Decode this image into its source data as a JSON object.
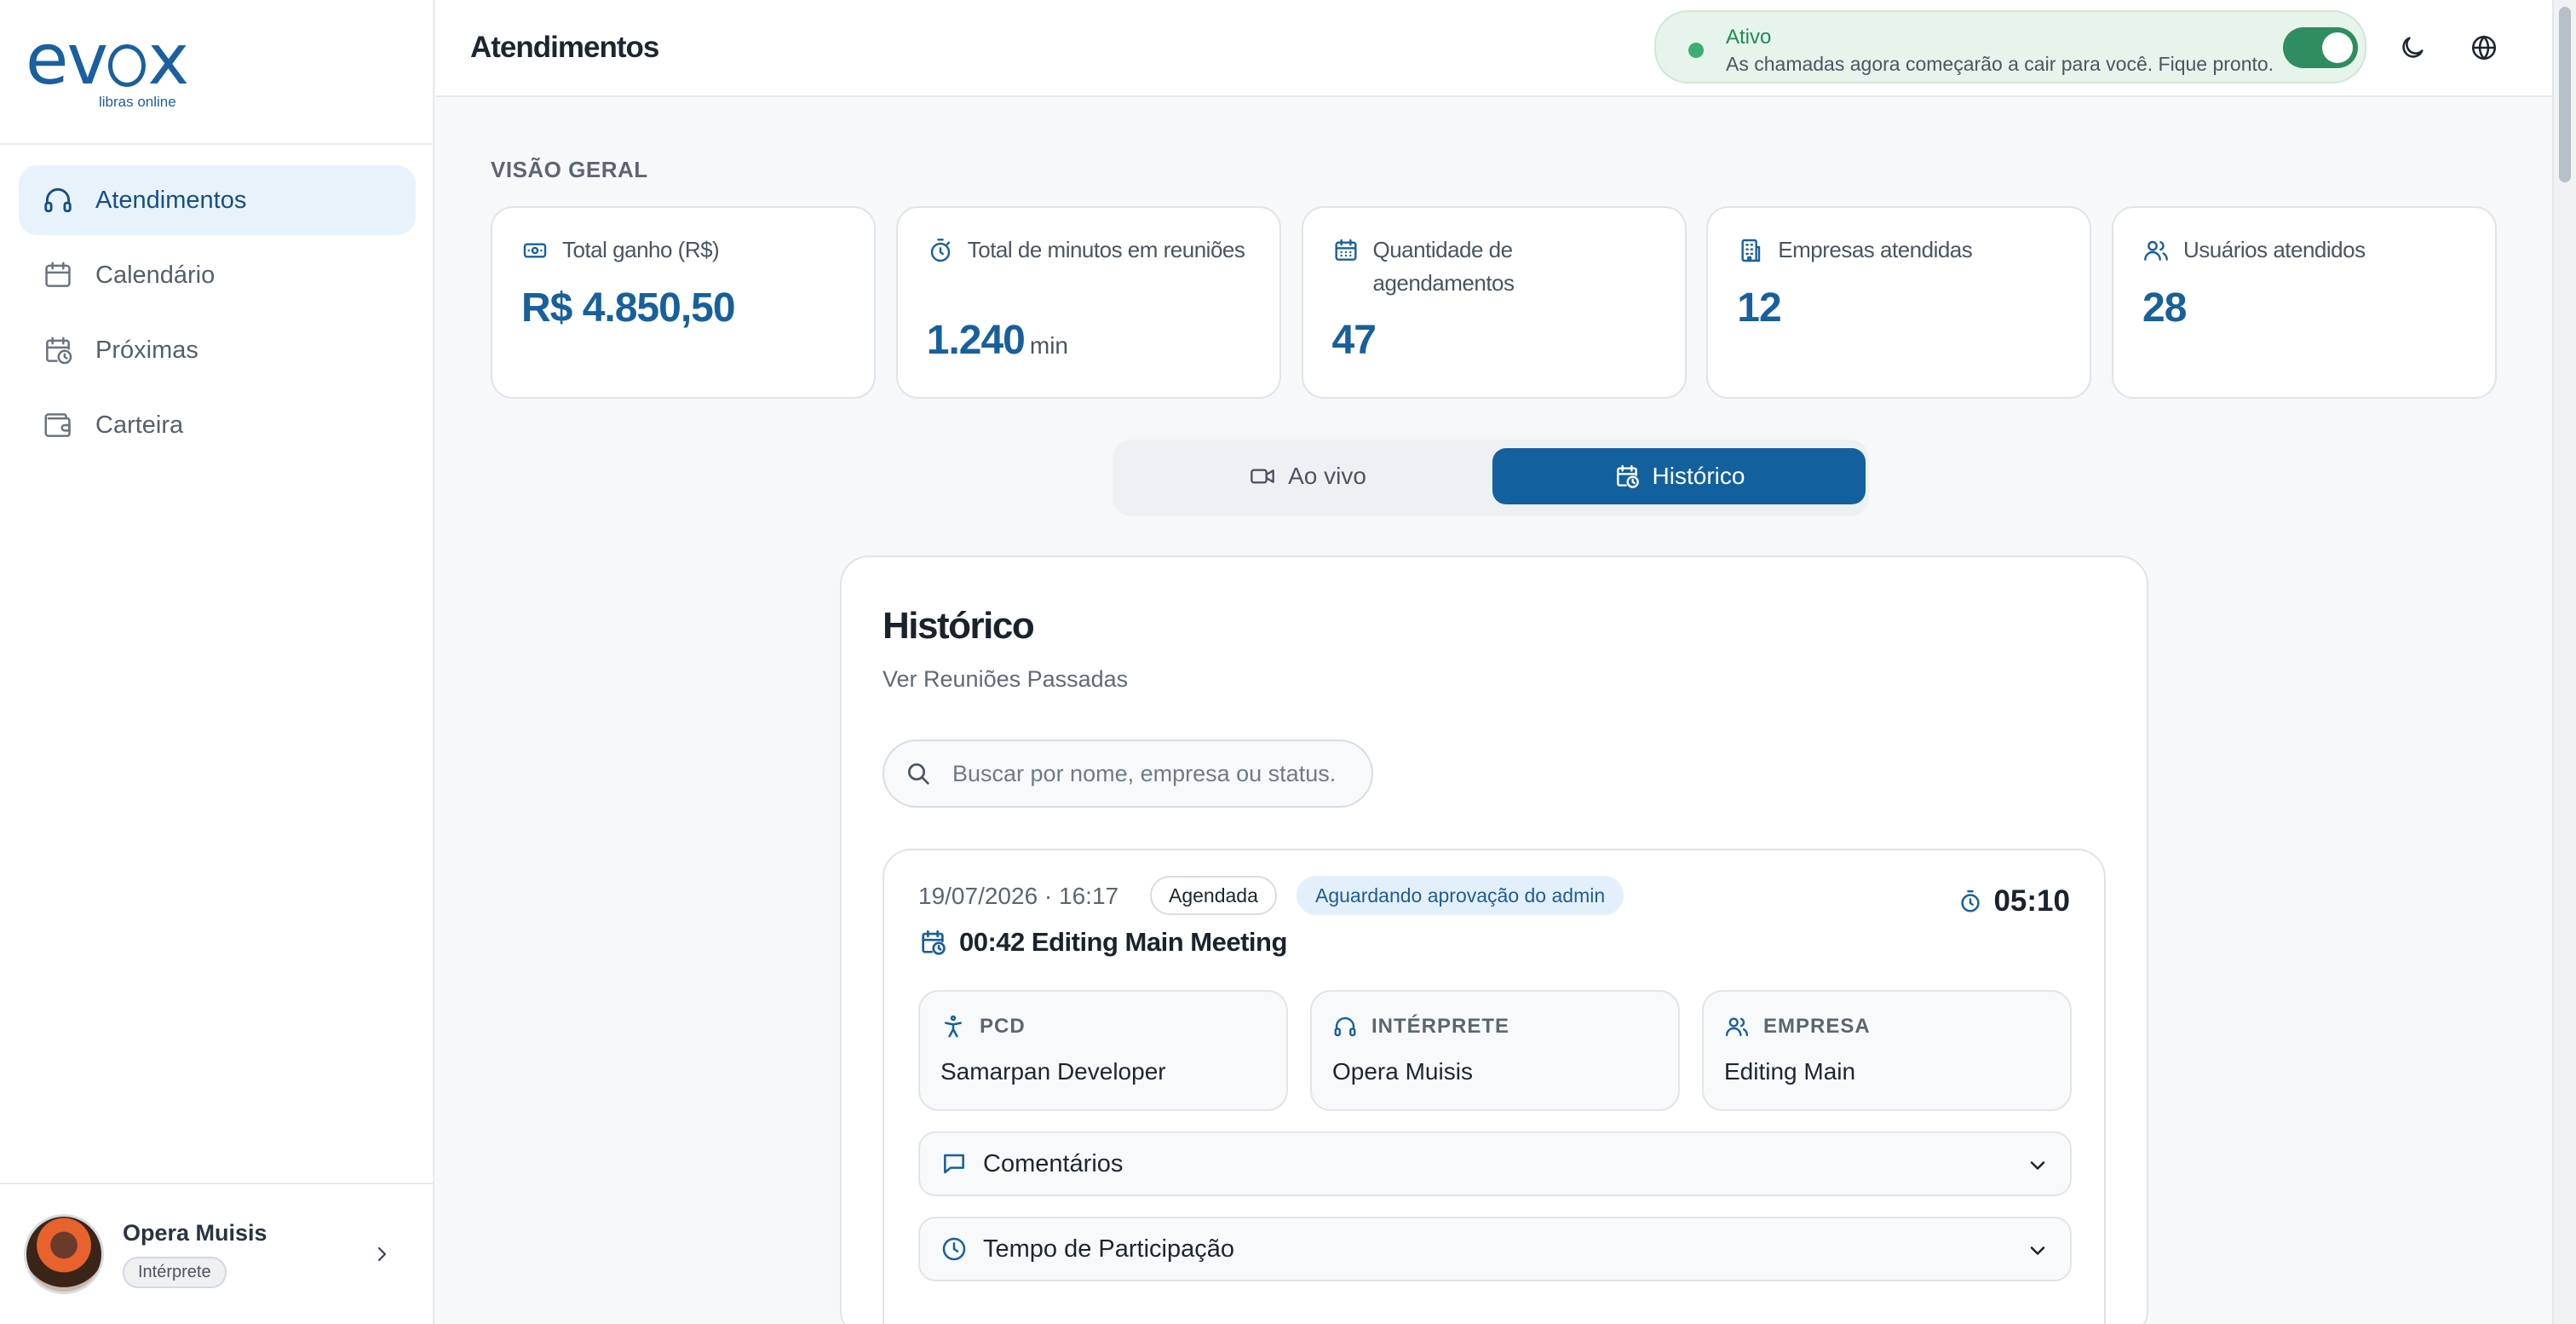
{
  "app": {
    "logo_text_left": "ev",
    "logo_text_right": "x",
    "logo_subtitle": "libras online",
    "brand_color": "#1a5fa0"
  },
  "sidebar": {
    "items": [
      {
        "label": "Atendimentos",
        "icon": "headset-icon",
        "active": true
      },
      {
        "label": "Calendário",
        "icon": "calendar-icon",
        "active": false
      },
      {
        "label": "Próximas",
        "icon": "calendar-clock-icon",
        "active": false
      },
      {
        "label": "Carteira",
        "icon": "wallet-icon",
        "active": false
      }
    ],
    "user": {
      "name": "Opera Muisis",
      "role": "Intérprete"
    }
  },
  "header": {
    "title": "Atendimentos",
    "status": {
      "title": "Ativo",
      "description": "As chamadas agora começarão a cair para você. Fique pronto.",
      "toggle_on": true,
      "color": "#2f8d5f"
    }
  },
  "overview": {
    "label": "VISÃO GERAL",
    "cards": [
      {
        "label": "Total ganho (R$)",
        "value": "R$ 4.850,50",
        "unit": "",
        "icon": "money-icon"
      },
      {
        "label": "Total de minutos em reuniões",
        "value": "1.240",
        "unit": "min",
        "icon": "stopwatch-icon"
      },
      {
        "label": "Quantidade de agendamentos",
        "value": "47",
        "unit": "",
        "icon": "calendar-icon"
      },
      {
        "label": "Empresas atendidas",
        "value": "12",
        "unit": "",
        "icon": "building-icon"
      },
      {
        "label": "Usuários atendidos",
        "value": "28",
        "unit": "",
        "icon": "users-icon"
      }
    ]
  },
  "tabs": {
    "live": "Ao vivo",
    "history": "Histórico",
    "active": "history"
  },
  "history": {
    "title": "Histórico",
    "subtitle": "Ver Reuniões Passadas",
    "search_placeholder": "Buscar por nome, empresa ou status.",
    "meeting": {
      "date": "19/07/2026 · 16:17",
      "status_badge": "Agendada",
      "approval_badge": "Aguardando aprovação do admin",
      "timer": "05:10",
      "title": "00:42 Editing Main Meeting",
      "participants": [
        {
          "role": "PCD",
          "name": "Samarpan Developer",
          "icon": "accessibility-icon"
        },
        {
          "role": "INTÉRPRETE",
          "name": "Opera Muisis",
          "icon": "headset-icon"
        },
        {
          "role": "EMPRESA",
          "name": "Editing Main",
          "icon": "users-icon"
        }
      ],
      "comments_label": "Comentários",
      "participation_label": "Tempo de Participação"
    }
  }
}
